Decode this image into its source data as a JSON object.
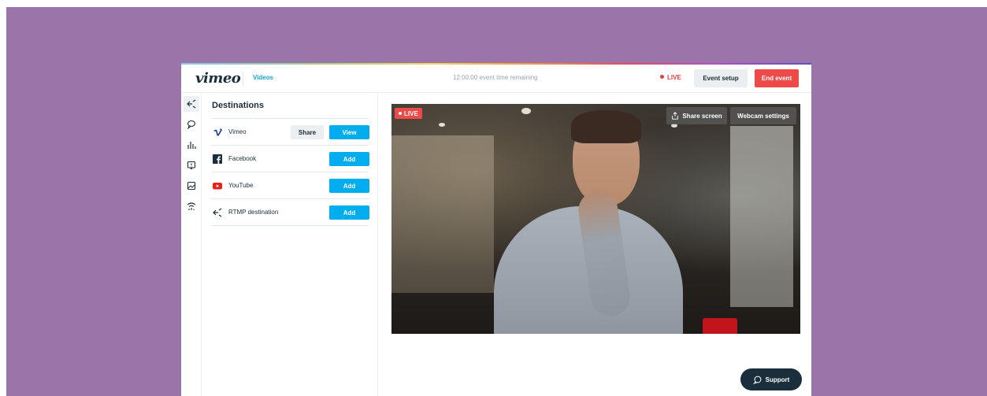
{
  "header": {
    "logo": "vimeo",
    "nav_videos": "Videos",
    "event_time_remaining": "12:00:00 event time remaining",
    "live_status": "LIVE",
    "event_setup_label": "Event setup",
    "end_event_label": "End event"
  },
  "rail": {
    "icons": [
      "destinations-icon",
      "chat-icon",
      "analytics-icon",
      "qa-icon",
      "graphics-icon",
      "stream-health-icon"
    ],
    "active": "destinations-icon"
  },
  "destinations": {
    "title": "Destinations",
    "items": [
      {
        "name": "Vimeo",
        "icon": "vimeo-icon",
        "share_label": "Share",
        "action_label": "View"
      },
      {
        "name": "Facebook",
        "icon": "facebook-icon",
        "action_label": "Add"
      },
      {
        "name": "YouTube",
        "icon": "youtube-icon",
        "action_label": "Add"
      },
      {
        "name": "RTMP destination",
        "icon": "rtmp-icon",
        "action_label": "Add"
      }
    ]
  },
  "preview": {
    "live_badge": "LIVE",
    "share_screen_label": "Share screen",
    "webcam_settings_label": "Webcam settings"
  },
  "support": {
    "label": "Support"
  },
  "colors": {
    "background": "#9b74a9",
    "accent_blue": "#00adef",
    "live_red": "#ef4a4a",
    "dark": "#1a2e3b"
  }
}
